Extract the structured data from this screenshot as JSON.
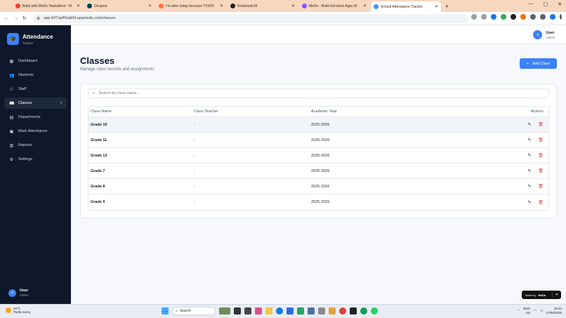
{
  "browser": {
    "tabs": [
      {
        "title": "Build with MeDo Hackathon - M",
        "icon_color": "#ea4335",
        "active": false
      },
      {
        "title": "Devpost",
        "icon_color": "#003e54",
        "active": false
      },
      {
        "title": "I'm alive today because YOU'R",
        "icon_color": "#ff6f3c",
        "active": false
      },
      {
        "title": "NotebookLM",
        "icon_color": "#222222",
        "active": false
      },
      {
        "title": "MeDo - Build full-stack Apps W",
        "icon_color": "#7c5cff",
        "active": false
      },
      {
        "title": "School Attendance Tracker",
        "icon_color": "#4a90e2",
        "active": true
      }
    ],
    "url": "app-b07vg49oqb5t.appmedo.com/classes"
  },
  "sidebar": {
    "app_title": "Attendance",
    "app_subtitle": "Tracker",
    "items": [
      {
        "label": "Dashboard",
        "icon": "grid-icon",
        "glyph": "▦"
      },
      {
        "label": "Students",
        "icon": "users-icon",
        "glyph": "👥"
      },
      {
        "label": "Staff",
        "icon": "user-check-icon",
        "glyph": "⚇"
      },
      {
        "label": "Classes",
        "icon": "book-icon",
        "glyph": "📖",
        "active": true
      },
      {
        "label": "Departments",
        "icon": "building-icon",
        "glyph": "▤"
      },
      {
        "label": "Mark Attendance",
        "icon": "clipboard-icon",
        "glyph": "▣"
      },
      {
        "label": "Reports",
        "icon": "bar-chart-icon",
        "glyph": "▥"
      },
      {
        "label": "Settings",
        "icon": "gear-icon",
        "glyph": "⚙"
      }
    ],
    "user": {
      "initial": "a",
      "name": "User",
      "role": "Admin"
    }
  },
  "header": {
    "user": {
      "initial": "a",
      "name": "User",
      "role": "Admin"
    }
  },
  "page": {
    "title": "Classes",
    "subtitle": "Manage class records and assignments",
    "add_button_label": "Add Class",
    "search_placeholder": "Search by class name...",
    "columns": [
      "Class Name",
      "Class Teacher",
      "Academic Year",
      "Actions"
    ],
    "rows": [
      {
        "name": "Grade 10",
        "teacher": "-",
        "year": "2025-2026"
      },
      {
        "name": "Grade 11",
        "teacher": "-",
        "year": "2025-2026"
      },
      {
        "name": "Grade 12",
        "teacher": "-",
        "year": "2025-2026"
      },
      {
        "name": "Grade 7",
        "teacher": "-",
        "year": "2025-2026"
      },
      {
        "name": "Grade 8",
        "teacher": "-",
        "year": "2025-2026"
      },
      {
        "name": "Grade 9",
        "teacher": "-",
        "year": "2025-2026"
      }
    ]
  },
  "badge": {
    "made_by": "Made by",
    "brand": "MeDo"
  },
  "taskbar": {
    "weather_temp": "33°C",
    "weather_desc": "Partly sunny",
    "search_label": "Search",
    "lang": "ENG",
    "region": "US",
    "time": "15:24",
    "date": "17/04/2026"
  },
  "colors": {
    "accent": "#3b82f6",
    "sidebar_bg": "#0f172a",
    "delete": "#ef4444"
  }
}
